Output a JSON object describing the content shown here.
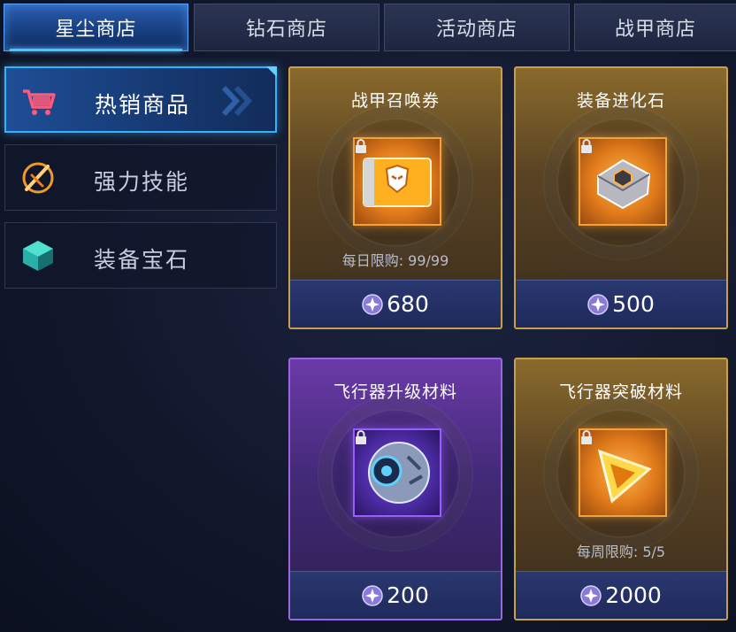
{
  "tabs": [
    {
      "label": "星尘商店",
      "active": true
    },
    {
      "label": "钻石商店",
      "active": false
    },
    {
      "label": "活动商店",
      "active": false
    },
    {
      "label": "战甲商店",
      "active": false
    }
  ],
  "sidebar": [
    {
      "label": "热销商品",
      "icon": "shopping-cart-icon",
      "active": true
    },
    {
      "label": "强力技能",
      "icon": "skill-slash-icon",
      "active": false
    },
    {
      "label": "装备宝石",
      "icon": "gem-cube-icon",
      "active": false
    }
  ],
  "items": [
    {
      "title": "战甲召唤券",
      "limit": "每日限购: 99/99",
      "price": "680",
      "rarity": "gold",
      "icon": "armor-ticket-icon"
    },
    {
      "title": "装备进化石",
      "limit": "",
      "price": "500",
      "rarity": "gold",
      "icon": "evolution-stone-icon"
    },
    {
      "title": "飞行器升级材料",
      "limit": "",
      "price": "200",
      "rarity": "purple",
      "icon": "aircraft-core-icon"
    },
    {
      "title": "飞行器突破材料",
      "limit": "每周限购: 5/5",
      "price": "2000",
      "rarity": "gold",
      "icon": "breakthrough-crystal-icon"
    }
  ],
  "currency": {
    "icon": "stardust-coin-icon"
  },
  "colors": {
    "accent": "#36b0ff",
    "gold": "#c9a04a",
    "purple": "#9a66e0"
  }
}
